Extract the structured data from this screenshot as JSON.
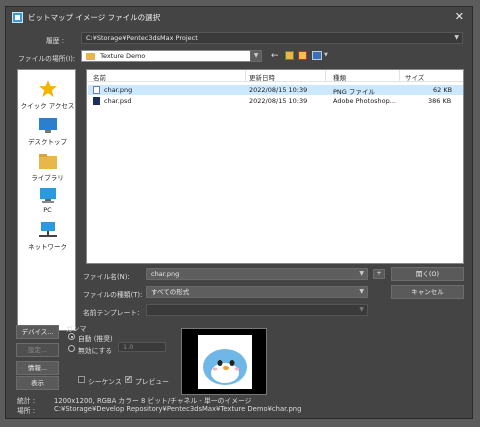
{
  "window": {
    "title": "ビットマップ イメージ ファイルの選択",
    "close_glyph": "✕"
  },
  "history": {
    "label": "履歴 :",
    "value": "C:¥Storage¥Pentec3dsMax Project"
  },
  "location": {
    "label": "ファイルの場所(I):",
    "value": "Texture Demo"
  },
  "places": [
    {
      "label": "クイック アクセス",
      "icon": "star-icon"
    },
    {
      "label": "デスクトップ",
      "icon": "desktop-icon"
    },
    {
      "label": "ライブラリ",
      "icon": "library-icon"
    },
    {
      "label": "PC",
      "icon": "pc-icon"
    },
    {
      "label": "ネットワーク",
      "icon": "network-icon"
    }
  ],
  "columns": [
    "名前",
    "更新日時",
    "種類",
    "サイズ"
  ],
  "files": [
    {
      "name": "char.png",
      "date": "2022/08/15 10:39",
      "type": "PNG ファイル",
      "size": "62 KB",
      "selected": true
    },
    {
      "name": "char.psd",
      "date": "2022/08/15 10:39",
      "type": "Adobe Photoshop...",
      "size": "386 KB",
      "selected": false
    }
  ],
  "filename": {
    "label": "ファイル名(N):",
    "value": "char.png"
  },
  "filetype": {
    "label": "ファイルの種類(T):",
    "value": "すべての形式"
  },
  "template": {
    "label": "名前テンプレート:",
    "value": ""
  },
  "buttons": {
    "open": "開く(O)",
    "cancel": "キャンセル",
    "plus": "+",
    "devices": "デバイス...",
    "setup": "設定...",
    "info": "情報...",
    "view": "表示"
  },
  "gamma": {
    "label": "ガンマ",
    "auto": "自動 (推奨)",
    "override": "無効にする",
    "override_value": "1.0"
  },
  "sequence": {
    "label": "シーケンス"
  },
  "preview_check": {
    "label": "プレビュー"
  },
  "stats": {
    "label": "統計 :",
    "value": "1200x1200, RGBA カラー 8 ビット/チャネル - 単一のイメージ"
  },
  "path": {
    "label": "場所 :",
    "value": "C:¥Storage¥Develop Repository¥Pentec3dsMax¥Texture Demo¥char.png"
  },
  "colors": {
    "accent": "#3d9ad6",
    "selection": "#cce8ff",
    "dialog": "#444444"
  }
}
